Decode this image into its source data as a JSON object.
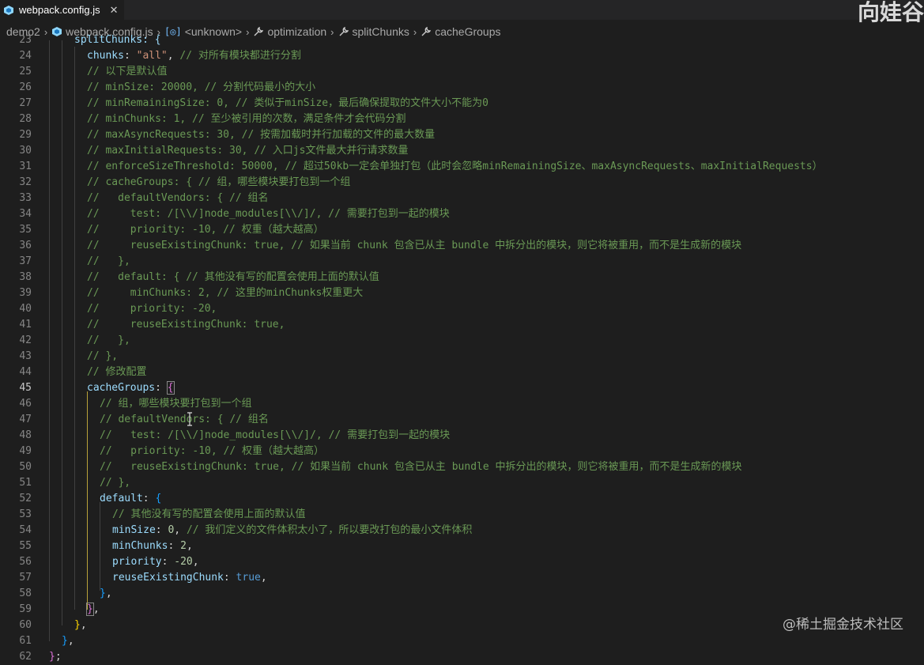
{
  "tab": {
    "label": "webpack.config.js",
    "close": "✕"
  },
  "watermark_top": "向娃谷",
  "breadcrumb": [
    "demo2",
    "webpack.config.js",
    "<unknown>",
    "optimization",
    "splitChunks",
    "cacheGroups"
  ],
  "line_numbers": [
    "23",
    "24",
    "25",
    "26",
    "27",
    "28",
    "29",
    "30",
    "31",
    "32",
    "33",
    "34",
    "35",
    "36",
    "37",
    "38",
    "39",
    "40",
    "41",
    "42",
    "43",
    "44",
    "45",
    "46",
    "47",
    "48",
    "49",
    "50",
    "51",
    "52",
    "53",
    "54",
    "55",
    "56",
    "57",
    "58",
    "59",
    "60",
    "61",
    "62"
  ],
  "active_line": "45",
  "code": {
    "l23": "splitChunks: {",
    "l24_key": "chunks",
    "l24_val": "\"all\"",
    "l24_comment": "// 对所有模块都进行分割",
    "l25": "// 以下是默认值",
    "l26": "// minSize: 20000, // 分割代码最小的大小",
    "l27": "// minRemainingSize: 0, // 类似于minSize，最后确保提取的文件大小不能为0",
    "l28": "// minChunks: 1, // 至少被引用的次数，满足条件才会代码分割",
    "l29": "// maxAsyncRequests: 30, // 按需加载时并行加载的文件的最大数量",
    "l30": "// maxInitialRequests: 30, // 入口js文件最大并行请求数量",
    "l31": "// enforceSizeThreshold: 50000, // 超过50kb一定会单独打包（此时会忽略minRemainingSize、maxAsyncRequests、maxInitialRequests）",
    "l32": "// cacheGroups: { // 组，哪些模块要打包到一个组",
    "l33": "//   defaultVendors: { // 组名",
    "l34": "//     test: /[\\\\/]node_modules[\\\\/]/, // 需要打包到一起的模块",
    "l35": "//     priority: -10, // 权重（越大越高）",
    "l36": "//     reuseExistingChunk: true, // 如果当前 chunk 包含已从主 bundle 中拆分出的模块，则它将被重用，而不是生成新的模块",
    "l37": "//   },",
    "l38": "//   default: { // 其他没有写的配置会使用上面的默认值",
    "l39": "//     minChunks: 2, // 这里的minChunks权重更大",
    "l40": "//     priority: -20,",
    "l41": "//     reuseExistingChunk: true,",
    "l42": "//   },",
    "l43": "// },",
    "l44": "// 修改配置",
    "l45_key": "cacheGroups",
    "l46": "// 组，哪些模块要打包到一个组",
    "l47": "// defaultVendors: { // 组名",
    "l48": "//   test: /[\\\\/]node_modules[\\\\/]/, // 需要打包到一起的模块",
    "l49": "//   priority: -10, // 权重（越大越高）",
    "l50": "//   reuseExistingChunk: true, // 如果当前 chunk 包含已从主 bundle 中拆分出的模块，则它将被重用，而不是生成新的模块",
    "l51": "// },",
    "l52_key": "default",
    "l53": "// 其他没有写的配置会使用上面的默认值",
    "l54_key": "minSize",
    "l54_val": "0",
    "l54_comment": "// 我们定义的文件体积太小了，所以要改打包的最小文件体积",
    "l55_key": "minChunks",
    "l55_val": "2",
    "l56_key": "priority",
    "l56_val": "-20",
    "l57_key": "reuseExistingChunk",
    "l57_val": "true"
  },
  "watermark_bottom": "@稀土掘金技术社区"
}
